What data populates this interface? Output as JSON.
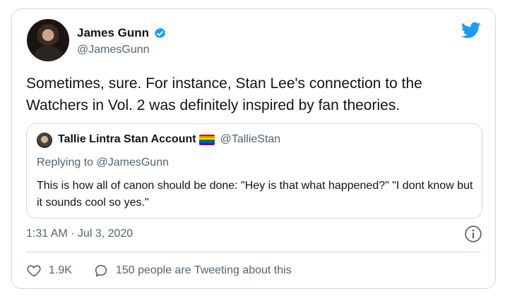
{
  "author": {
    "name": "James Gunn",
    "handle": "@JamesGunn",
    "verified_color": "#1d9bf0"
  },
  "tweet": {
    "text": "Sometimes, sure. For instance, Stan Lee's connection to the Watchers in Vol. 2 was definitely inspired by fan theories."
  },
  "quoted_tweet": {
    "author_name": "Tallie Lintra Stan Account",
    "author_handle": "@TallieStan",
    "replying_to": "Replying to @JamesGunn",
    "text": "This is how all of canon should be done: \"Hey is that what happened?\" \"I dont know but it sounds cool so yes.\""
  },
  "meta": {
    "timestamp": "1:31 AM · Jul 3, 2020"
  },
  "actions": {
    "likes": "1.9K",
    "tweeting_about": "150 people are Tweeting about this"
  },
  "icons": {
    "brand": "twitter-bird-icon",
    "verified": "verified-badge-icon",
    "info": "info-icon",
    "like": "heart-icon",
    "reply": "speech-bubble-icon"
  },
  "colors": {
    "brand": "#1d9bf0",
    "text": "#0f1419",
    "muted": "#536471",
    "border": "#cfd9de"
  }
}
